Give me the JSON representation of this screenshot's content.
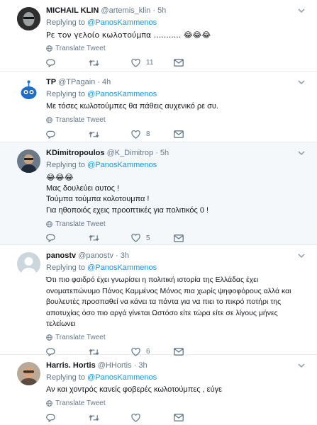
{
  "tweets": [
    {
      "name": "MICHAIL KLIN",
      "handle": "@artemis_klin",
      "time": "· 5h",
      "reply_prefix": "Replying to",
      "reply_to": "@PanosKammenos",
      "lines": [
        "Ρε τον γελοίο κωλοτούμπα ........... 😂😂😂"
      ],
      "translate": "Translate Tweet",
      "counts": {
        "reply": "",
        "retweet": "",
        "like": "11",
        "dm": ""
      }
    },
    {
      "name": "TP",
      "handle": "@TPagain",
      "time": "· 4h",
      "reply_prefix": "Replying to",
      "reply_to": "@PanosKammenos",
      "lines": [
        "Με τόσες κωλοτούμπες θα πάθεις αυχενικό ρε συ."
      ],
      "translate": "Translate Tweet",
      "counts": {
        "reply": "",
        "retweet": "",
        "like": "8",
        "dm": ""
      }
    },
    {
      "name": "KDimitropoulos",
      "handle": "@K_Dimitrop",
      "time": "· 5h",
      "reply_prefix": "Replying to",
      "reply_to": "@PanosKammenos",
      "lines": [
        "😂😂😂",
        "Μας δουλεύει αυτος !",
        "Τούμπα τούμπα κολοτουμπα !",
        "Για ηθοποιός εχεις προοπτικές για πολιτικός 0 !"
      ],
      "translate": "Translate Tweet",
      "counts": {
        "reply": "",
        "retweet": "",
        "like": "5",
        "dm": ""
      }
    },
    {
      "name": "panostv",
      "handle": "@panostv",
      "time": "· 3h",
      "reply_prefix": "Replying to",
      "reply_to": "@PanosKammenos",
      "lines": [
        "Ότι πιο φαιδρό έχει γνωρίσει η πολιτική ιστορία της Ελλάδας έχει",
        "ονοματεπώνυμο Πάνος Καμμένος Μόνος πια χωρίς ψηφοφόρους αλλά και",
        "βουλευτές προσπαθεί να κάνει τα πάντα για να πιει το πικρό ποτήρι της",
        "αποτυχίας όσο πιο αργά γίνεται Ωστόσο είτε τώρα είτε σε λίγους μήνες",
        "τελείωνει"
      ],
      "translate": "Translate Tweet",
      "counts": {
        "reply": "",
        "retweet": "",
        "like": "6",
        "dm": ""
      }
    },
    {
      "name": "Harris. Hortis",
      "handle": "@HHortis",
      "time": "· 3h",
      "reply_prefix": "Replying to",
      "reply_to": "@PanosKammenos",
      "lines": [
        "Αν και χοντρός κανείς φοβερές κωλοτούμπες , εύγε"
      ],
      "translate": "Translate Tweet",
      "counts": {
        "reply": "",
        "retweet": "",
        "like": "",
        "dm": ""
      }
    }
  ],
  "colors": {
    "link": "#1b95e0",
    "muted": "#657786",
    "text": "#14171a",
    "highlight": "#f5f8fa"
  }
}
